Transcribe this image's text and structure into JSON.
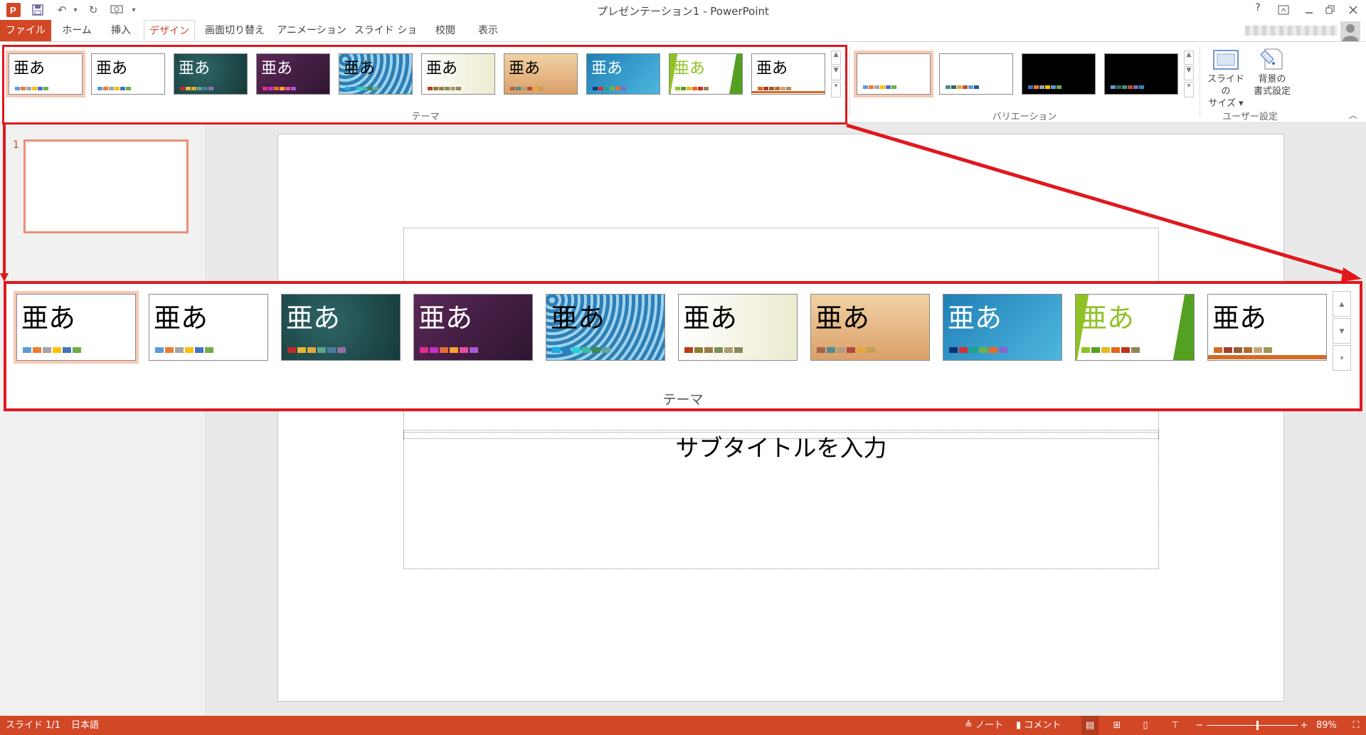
{
  "app": {
    "title": "プレゼンテーション1 - PowerPoint",
    "help": "?",
    "app_icon": "P"
  },
  "tabs": [
    {
      "label": "ファイル"
    },
    {
      "label": "ホーム"
    },
    {
      "label": "挿入"
    },
    {
      "label": "デザイン"
    },
    {
      "label": "画面切り替え"
    },
    {
      "label": "アニメーション"
    },
    {
      "label": "スライド ショー"
    },
    {
      "label": "校閲"
    },
    {
      "label": "表示"
    }
  ],
  "ribbon": {
    "themes_label": "テーマ",
    "variations_label": "バリエーション",
    "user_settings_label": "ユーザー設定",
    "slide_size_line1": "スライドの",
    "slide_size_line2": "サイズ ▾",
    "format_bg_line1": "背景の",
    "format_bg_line2": "書式設定",
    "theme_text": "亜あ"
  },
  "themes": [
    {
      "name": "office",
      "bg": "#ffffff",
      "text": "#000000",
      "colors": [
        "#5b9bd5",
        "#ed7d31",
        "#a5a5a5",
        "#ffc000",
        "#4472c4",
        "#70ad47"
      ]
    },
    {
      "name": "office-2",
      "bg": "#ffffff",
      "text": "#000000",
      "colors": [
        "#5b9bd5",
        "#ed7d31",
        "#a5a5a5",
        "#ffc000",
        "#4472c4",
        "#70ad47"
      ]
    },
    {
      "name": "chalk",
      "bg": "#1f4a4a",
      "text": "#ffffff",
      "colors": [
        "#c0282d",
        "#e5b82f",
        "#e3a839",
        "#5fa38b",
        "#4d7a9e",
        "#926fa8"
      ]
    },
    {
      "name": "purple",
      "bg": "#4a2048",
      "text": "#ffffff",
      "colors": [
        "#e32d91",
        "#c830cc",
        "#e86a33",
        "#f7a22b",
        "#e84f9e",
        "#a55bd3"
      ]
    },
    {
      "name": "pattern",
      "bg": "#3b8cbf",
      "text": "#000000",
      "colors": [
        "#1cade4",
        "#2683c6",
        "#27ced7",
        "#42ba97",
        "#3e8853",
        "#62a39f"
      ]
    },
    {
      "name": "retro",
      "bg": "#f2f2e0",
      "text": "#000000",
      "colors": [
        "#b83d18",
        "#8f7c31",
        "#9a7b42",
        "#7f8f54",
        "#b09b6e",
        "#8a8a5c"
      ]
    },
    {
      "name": "wood",
      "bg": "#e8c28c",
      "text": "#000000",
      "colors": [
        "#a5644e",
        "#4f8b8b",
        "#b19c7d",
        "#b5443f",
        "#e3a93d",
        "#c1a04d"
      ]
    },
    {
      "name": "ion",
      "bg": "#2b93c8",
      "text": "#ffffff",
      "colors": [
        "#0f2f75",
        "#da2e2e",
        "#1aa58a",
        "#72b249",
        "#f06923",
        "#8864c9"
      ]
    },
    {
      "name": "facet",
      "bg": "#ffffff",
      "text": "#90c226",
      "colors": [
        "#90c226",
        "#54a021",
        "#e6b91e",
        "#e76618",
        "#c42f1a",
        "#918655"
      ]
    },
    {
      "name": "banded",
      "bg": "#ffffff",
      "text": "#000000",
      "colors": [
        "#d26b27",
        "#a63e29",
        "#975b34",
        "#b06b2e",
        "#c7a77a",
        "#a0975b"
      ]
    }
  ],
  "variations": [
    {
      "bg": "#ffffff",
      "colors": [
        "#5b9bd5",
        "#ed7d31",
        "#a5a5a5",
        "#ffc000",
        "#4472c4",
        "#70ad47"
      ]
    },
    {
      "bg": "#ffffff",
      "colors": [
        "#4a8c7c",
        "#2e6a5c",
        "#e4a53b",
        "#c74a31",
        "#5b9bd5",
        "#1d5b8a"
      ]
    },
    {
      "bg": "#000000",
      "colors": [
        "#4472c4",
        "#ed7d31",
        "#a5a5a5",
        "#ffc000",
        "#5b9bd5",
        "#70ad47"
      ]
    },
    {
      "bg": "#000000",
      "colors": [
        "#5b9bd5",
        "#2e6a5c",
        "#4a8c7c",
        "#c74a31",
        "#7b6fb2",
        "#1d8fc1"
      ]
    }
  ],
  "slide_panel": {
    "number": "1"
  },
  "slide": {
    "subtitle": "サブタイトルを入力"
  },
  "zoom": {
    "label": "テーマ"
  },
  "status": {
    "slide_info": "スライド 1/1",
    "language": "日本語",
    "notes": "ノート",
    "comments": "コメント",
    "zoom_minus": "−",
    "zoom_plus": "+",
    "zoom_level": "89%",
    "zoom_slider_fraction": 0.55
  },
  "colors": {
    "accent": "#d24726",
    "highlight": "#e0181e"
  }
}
